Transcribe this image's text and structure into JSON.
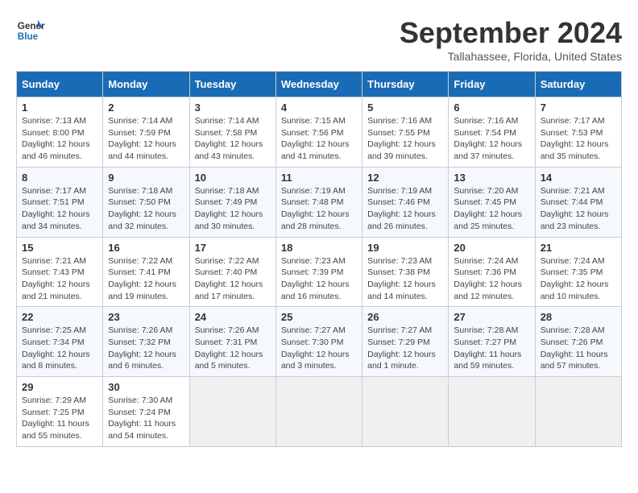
{
  "logo": {
    "line1": "General",
    "line2": "Blue"
  },
  "title": "September 2024",
  "location": "Tallahassee, Florida, United States",
  "days_of_week": [
    "Sunday",
    "Monday",
    "Tuesday",
    "Wednesday",
    "Thursday",
    "Friday",
    "Saturday"
  ],
  "weeks": [
    [
      {
        "day": "1",
        "detail": "Sunrise: 7:13 AM\nSunset: 8:00 PM\nDaylight: 12 hours\nand 46 minutes."
      },
      {
        "day": "2",
        "detail": "Sunrise: 7:14 AM\nSunset: 7:59 PM\nDaylight: 12 hours\nand 44 minutes."
      },
      {
        "day": "3",
        "detail": "Sunrise: 7:14 AM\nSunset: 7:58 PM\nDaylight: 12 hours\nand 43 minutes."
      },
      {
        "day": "4",
        "detail": "Sunrise: 7:15 AM\nSunset: 7:56 PM\nDaylight: 12 hours\nand 41 minutes."
      },
      {
        "day": "5",
        "detail": "Sunrise: 7:16 AM\nSunset: 7:55 PM\nDaylight: 12 hours\nand 39 minutes."
      },
      {
        "day": "6",
        "detail": "Sunrise: 7:16 AM\nSunset: 7:54 PM\nDaylight: 12 hours\nand 37 minutes."
      },
      {
        "day": "7",
        "detail": "Sunrise: 7:17 AM\nSunset: 7:53 PM\nDaylight: 12 hours\nand 35 minutes."
      }
    ],
    [
      {
        "day": "8",
        "detail": "Sunrise: 7:17 AM\nSunset: 7:51 PM\nDaylight: 12 hours\nand 34 minutes."
      },
      {
        "day": "9",
        "detail": "Sunrise: 7:18 AM\nSunset: 7:50 PM\nDaylight: 12 hours\nand 32 minutes."
      },
      {
        "day": "10",
        "detail": "Sunrise: 7:18 AM\nSunset: 7:49 PM\nDaylight: 12 hours\nand 30 minutes."
      },
      {
        "day": "11",
        "detail": "Sunrise: 7:19 AM\nSunset: 7:48 PM\nDaylight: 12 hours\nand 28 minutes."
      },
      {
        "day": "12",
        "detail": "Sunrise: 7:19 AM\nSunset: 7:46 PM\nDaylight: 12 hours\nand 26 minutes."
      },
      {
        "day": "13",
        "detail": "Sunrise: 7:20 AM\nSunset: 7:45 PM\nDaylight: 12 hours\nand 25 minutes."
      },
      {
        "day": "14",
        "detail": "Sunrise: 7:21 AM\nSunset: 7:44 PM\nDaylight: 12 hours\nand 23 minutes."
      }
    ],
    [
      {
        "day": "15",
        "detail": "Sunrise: 7:21 AM\nSunset: 7:43 PM\nDaylight: 12 hours\nand 21 minutes."
      },
      {
        "day": "16",
        "detail": "Sunrise: 7:22 AM\nSunset: 7:41 PM\nDaylight: 12 hours\nand 19 minutes."
      },
      {
        "day": "17",
        "detail": "Sunrise: 7:22 AM\nSunset: 7:40 PM\nDaylight: 12 hours\nand 17 minutes."
      },
      {
        "day": "18",
        "detail": "Sunrise: 7:23 AM\nSunset: 7:39 PM\nDaylight: 12 hours\nand 16 minutes."
      },
      {
        "day": "19",
        "detail": "Sunrise: 7:23 AM\nSunset: 7:38 PM\nDaylight: 12 hours\nand 14 minutes."
      },
      {
        "day": "20",
        "detail": "Sunrise: 7:24 AM\nSunset: 7:36 PM\nDaylight: 12 hours\nand 12 minutes."
      },
      {
        "day": "21",
        "detail": "Sunrise: 7:24 AM\nSunset: 7:35 PM\nDaylight: 12 hours\nand 10 minutes."
      }
    ],
    [
      {
        "day": "22",
        "detail": "Sunrise: 7:25 AM\nSunset: 7:34 PM\nDaylight: 12 hours\nand 8 minutes."
      },
      {
        "day": "23",
        "detail": "Sunrise: 7:26 AM\nSunset: 7:32 PM\nDaylight: 12 hours\nand 6 minutes."
      },
      {
        "day": "24",
        "detail": "Sunrise: 7:26 AM\nSunset: 7:31 PM\nDaylight: 12 hours\nand 5 minutes."
      },
      {
        "day": "25",
        "detail": "Sunrise: 7:27 AM\nSunset: 7:30 PM\nDaylight: 12 hours\nand 3 minutes."
      },
      {
        "day": "26",
        "detail": "Sunrise: 7:27 AM\nSunset: 7:29 PM\nDaylight: 12 hours\nand 1 minute."
      },
      {
        "day": "27",
        "detail": "Sunrise: 7:28 AM\nSunset: 7:27 PM\nDaylight: 11 hours\nand 59 minutes."
      },
      {
        "day": "28",
        "detail": "Sunrise: 7:28 AM\nSunset: 7:26 PM\nDaylight: 11 hours\nand 57 minutes."
      }
    ],
    [
      {
        "day": "29",
        "detail": "Sunrise: 7:29 AM\nSunset: 7:25 PM\nDaylight: 11 hours\nand 55 minutes."
      },
      {
        "day": "30",
        "detail": "Sunrise: 7:30 AM\nSunset: 7:24 PM\nDaylight: 11 hours\nand 54 minutes."
      },
      {
        "day": "",
        "detail": ""
      },
      {
        "day": "",
        "detail": ""
      },
      {
        "day": "",
        "detail": ""
      },
      {
        "day": "",
        "detail": ""
      },
      {
        "day": "",
        "detail": ""
      }
    ]
  ]
}
